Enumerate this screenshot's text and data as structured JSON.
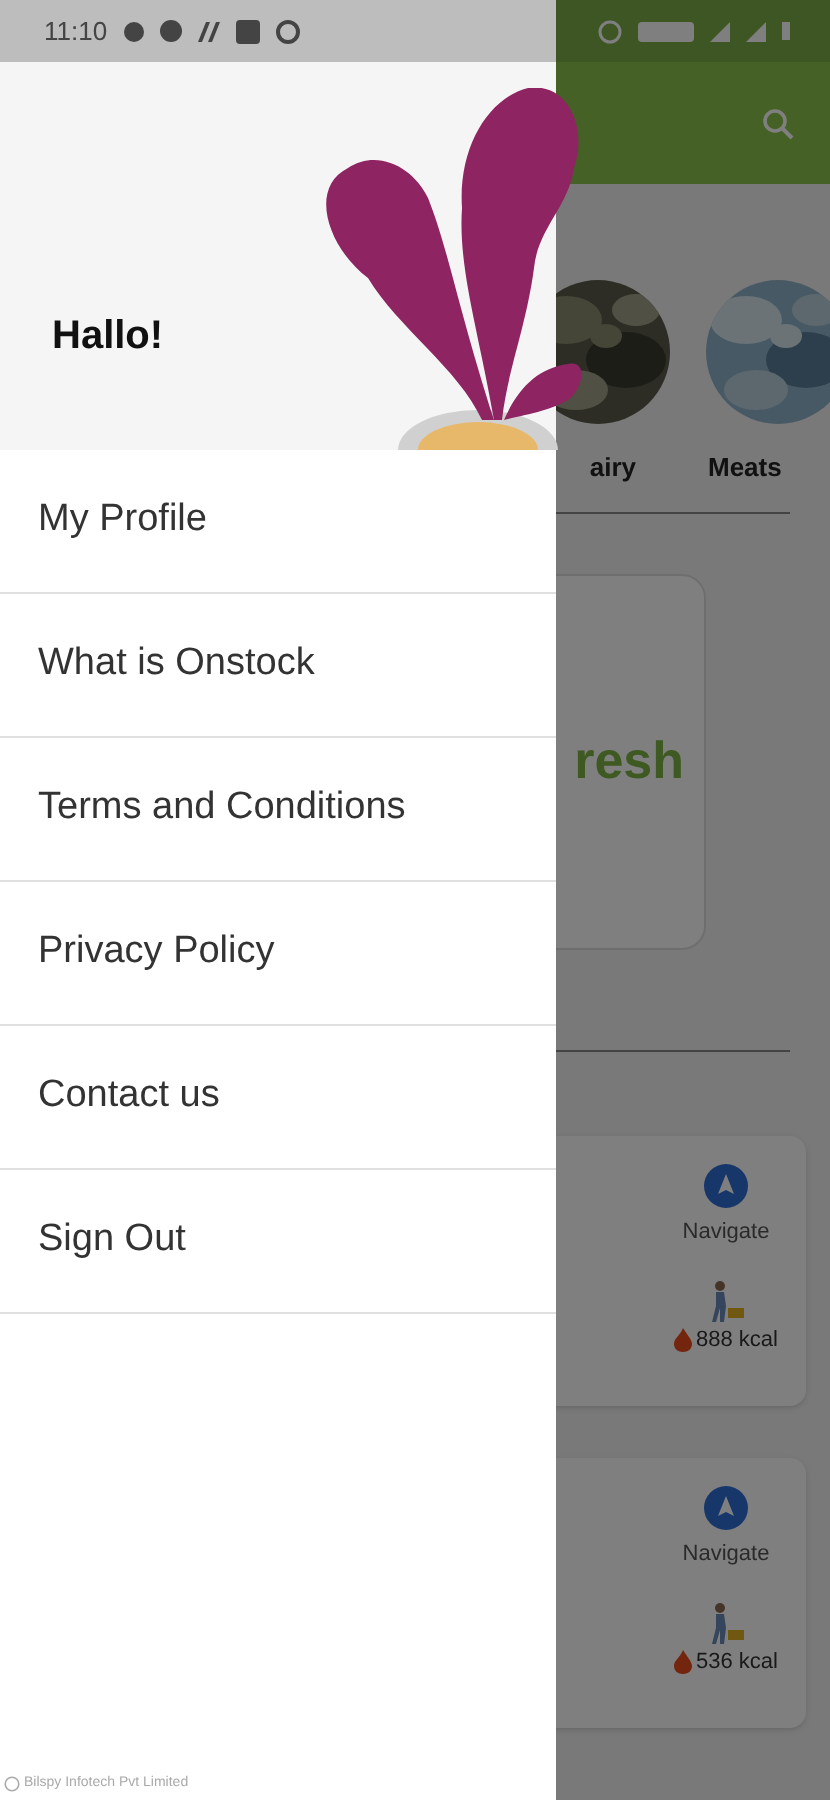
{
  "status_bar": {
    "time": "11:10"
  },
  "drawer": {
    "greeting": "Hallo!",
    "menu_items": [
      {
        "label": "My Profile"
      },
      {
        "label": "What is Onstock"
      },
      {
        "label": "Terms and Conditions"
      },
      {
        "label": "Privacy Policy"
      },
      {
        "label": "Contact us"
      },
      {
        "label": "Sign Out"
      }
    ],
    "footer": "Bilspy Infotech Pvt Limited"
  },
  "background": {
    "categories": [
      {
        "label": "airy"
      },
      {
        "label": "Meats"
      }
    ],
    "banner_text": "resh",
    "cards": [
      {
        "action": "Navigate",
        "calories": "888 kcal"
      },
      {
        "action": "Navigate",
        "calories": "536 kcal"
      }
    ]
  }
}
